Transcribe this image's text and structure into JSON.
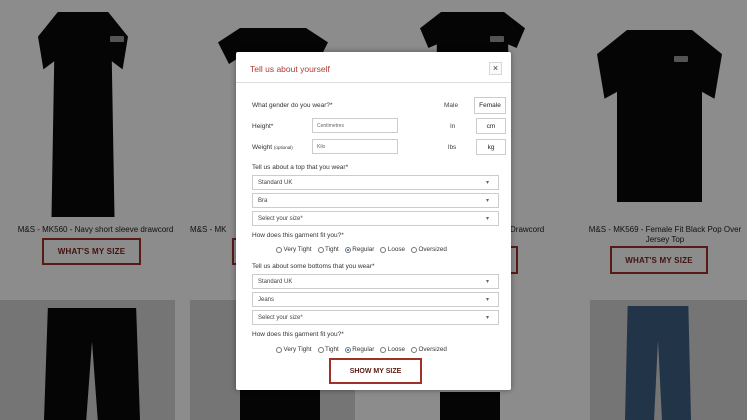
{
  "products": [
    {
      "caption": "M&S - MK560 - Navy short sleeve drawcord",
      "button": "WHAT'S MY SIZE"
    },
    {
      "caption": "M&S - MK",
      "button": "WH"
    },
    {
      "caption": "Drawcord",
      "button": ""
    },
    {
      "caption": "M&S - MK569 - Female Fit Black Pop Over Jersey Top",
      "button": "WHAT'S MY SIZE"
    }
  ],
  "modal": {
    "title": "Tell us about yourself",
    "close_symbol": "×",
    "gender": {
      "question": "What gender do you wear?*",
      "male": "Male",
      "female": "Female"
    },
    "height": {
      "label": "Height*",
      "placeholder": "Centimetres",
      "unit_in": "In",
      "unit_cm": "cm"
    },
    "weight": {
      "label": "Weight",
      "optional": "(optional)",
      "placeholder": "Kilo",
      "unit_lbs": "lbs",
      "unit_kg": "kg"
    },
    "top": {
      "question": "Tell us about a top that you wear*",
      "system": "Standard UK",
      "garment": "Bra",
      "size": "Select your size*",
      "fit_question": "How does this garment fit you?*"
    },
    "bottoms": {
      "question": "Tell us about some bottoms that you wear*",
      "system": "Standard UK",
      "garment": "Jeans",
      "size": "Select your size*",
      "fit_question": "How does this garment fit you?*"
    },
    "fit_options": [
      "Very Tight",
      "Tight",
      "Regular",
      "Loose",
      "Oversized"
    ],
    "selected_fit_top": "Regular",
    "selected_fit_bottoms": "Regular",
    "caret": "▾",
    "submit": "SHOW MY SIZE"
  },
  "colors": {
    "accent": "#a0302a",
    "title": "#b03a32",
    "overlay": "rgba(0,0,0,0.45)"
  }
}
